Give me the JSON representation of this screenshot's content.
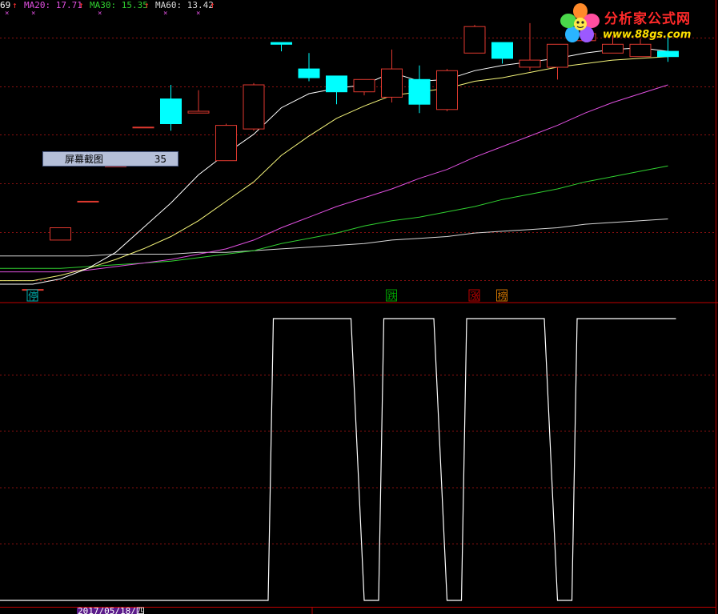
{
  "header": {
    "ma_prev": "69",
    "ma20": "MA20: 17.71",
    "ma30": "MA30: 15.35",
    "ma60": "MA60: 13.42",
    "arrow": "↑",
    "mark": "×"
  },
  "logo": {
    "title": "分析家公式网",
    "url": "www.88gs.com"
  },
  "screenshot_box": {
    "label": "屏幕截图",
    "value": "35"
  },
  "footer": {
    "date": "2017/05/18/四"
  },
  "signals": [
    {
      "text": "停",
      "candle": 0,
      "color": "#00b0b0"
    },
    {
      "text": "跌",
      "candle": 13,
      "color": "#00a000"
    },
    {
      "text": "涨",
      "candle": 16,
      "color": "#c00000"
    },
    {
      "text": "榜",
      "candle": 17,
      "color": "#c87000"
    }
  ],
  "colors": {
    "up": "#e0392f",
    "down": "#00ffff",
    "grid": "#8a1010",
    "ma5": "#ffffff",
    "ma10": "#f5f57a",
    "ma20": "#e050e0",
    "ma30": "#30d030",
    "ma60": "#d8d8d8"
  },
  "chart_data": [
    {
      "type": "candlestick",
      "title": "",
      "ylim": [
        9.3,
        24.5
      ],
      "candles": [
        {
          "o": 9.0,
          "h": 9.0,
          "l": 9.0,
          "c": 9.0
        },
        {
          "o": 11.8,
          "h": 12.0,
          "l": 11.8,
          "c": 12.5
        },
        {
          "o": 14.0,
          "h": 14.0,
          "l": 14.0,
          "c": 14.0
        },
        {
          "o": 16.0,
          "h": 16.0,
          "l": 16.0,
          "c": 16.0
        },
        {
          "o": 18.2,
          "h": 18.2,
          "l": 18.2,
          "c": 18.2
        },
        {
          "o": 19.8,
          "h": 20.6,
          "l": 18.0,
          "c": 18.4
        },
        {
          "o": 19.0,
          "h": 20.3,
          "l": 19.0,
          "c": 19.1
        },
        {
          "o": 16.3,
          "h": 18.4,
          "l": 16.3,
          "c": 18.3
        },
        {
          "o": 18.1,
          "h": 20.7,
          "l": 18.0,
          "c": 20.6
        },
        {
          "o": 23.0,
          "h": 23.0,
          "l": 22.5,
          "c": 22.9
        },
        {
          "o": 21.5,
          "h": 22.4,
          "l": 20.8,
          "c": 21.0
        },
        {
          "o": 21.1,
          "h": 21.1,
          "l": 19.5,
          "c": 20.2
        },
        {
          "o": 20.2,
          "h": 20.7,
          "l": 20.0,
          "c": 20.9
        },
        {
          "o": 19.9,
          "h": 22.6,
          "l": 19.6,
          "c": 21.5
        },
        {
          "o": 20.9,
          "h": 21.7,
          "l": 19.0,
          "c": 19.5
        },
        {
          "o": 19.2,
          "h": 21.5,
          "l": 19.1,
          "c": 21.4
        },
        {
          "o": 22.4,
          "h": 24.0,
          "l": 22.4,
          "c": 23.9
        },
        {
          "o": 23.0,
          "h": 23.0,
          "l": 21.8,
          "c": 22.1
        },
        {
          "o": 21.6,
          "h": 24.1,
          "l": 21.4,
          "c": 22.0
        },
        {
          "o": 21.6,
          "h": 22.3,
          "l": 20.9,
          "c": 22.9
        },
        {
          "o": 23.1,
          "h": 23.5,
          "l": 23.0,
          "c": 23.5
        },
        {
          "o": 22.4,
          "h": 23.4,
          "l": 22.4,
          "c": 22.9
        },
        {
          "o": 22.2,
          "h": 23.2,
          "l": 22.2,
          "c": 22.9
        },
        {
          "o": 22.5,
          "h": 23.3,
          "l": 21.9,
          "c": 22.2
        }
      ],
      "ma5": [
        9.3,
        9.6,
        10.2,
        11.1,
        12.5,
        13.9,
        15.5,
        16.7,
        17.8,
        19.3,
        20.1,
        20.4,
        20.6,
        21.3,
        20.8,
        20.9,
        21.4,
        21.7,
        21.9,
        22.1,
        22.4,
        22.6,
        22.7,
        22.5
      ],
      "ma10": [
        9.5,
        9.8,
        10.2,
        10.7,
        11.3,
        12.0,
        12.9,
        14.0,
        15.1,
        16.6,
        17.7,
        18.7,
        19.4,
        20.0,
        20.2,
        20.4,
        20.8,
        21.0,
        21.3,
        21.6,
        21.8,
        22.0,
        22.1,
        22.2
      ],
      "ma20": [
        10.0,
        10.0,
        10.1,
        10.3,
        10.5,
        10.7,
        11.0,
        11.3,
        11.8,
        12.5,
        13.1,
        13.7,
        14.2,
        14.7,
        15.3,
        15.8,
        16.5,
        17.1,
        17.7,
        18.3,
        19.0,
        19.6,
        20.1,
        20.6
      ],
      "ma30": [
        10.2,
        10.2,
        10.3,
        10.4,
        10.5,
        10.6,
        10.8,
        11.0,
        11.2,
        11.6,
        11.9,
        12.2,
        12.6,
        12.9,
        13.1,
        13.4,
        13.7,
        14.1,
        14.4,
        14.7,
        15.1,
        15.4,
        15.7,
        16.0
      ],
      "ma60": [
        10.9,
        10.9,
        10.9,
        11.0,
        11.0,
        11.0,
        11.1,
        11.1,
        11.2,
        11.3,
        11.4,
        11.5,
        11.6,
        11.8,
        11.9,
        12.0,
        12.2,
        12.3,
        12.4,
        12.5,
        12.7,
        12.8,
        12.9,
        13.0
      ]
    },
    {
      "type": "line",
      "title": "",
      "ylim": [
        0,
        1
      ],
      "x": [
        0,
        1,
        2,
        3,
        4,
        5,
        6,
        7,
        8,
        9,
        10,
        11,
        12,
        13,
        14,
        15,
        16,
        17,
        18,
        19,
        20,
        21,
        22,
        23
      ],
      "values": [
        0,
        0,
        0,
        0,
        0,
        0,
        0,
        0,
        0,
        1,
        1,
        1,
        0,
        1,
        1,
        0,
        1,
        1,
        1,
        0,
        1,
        1,
        1,
        1
      ]
    }
  ]
}
